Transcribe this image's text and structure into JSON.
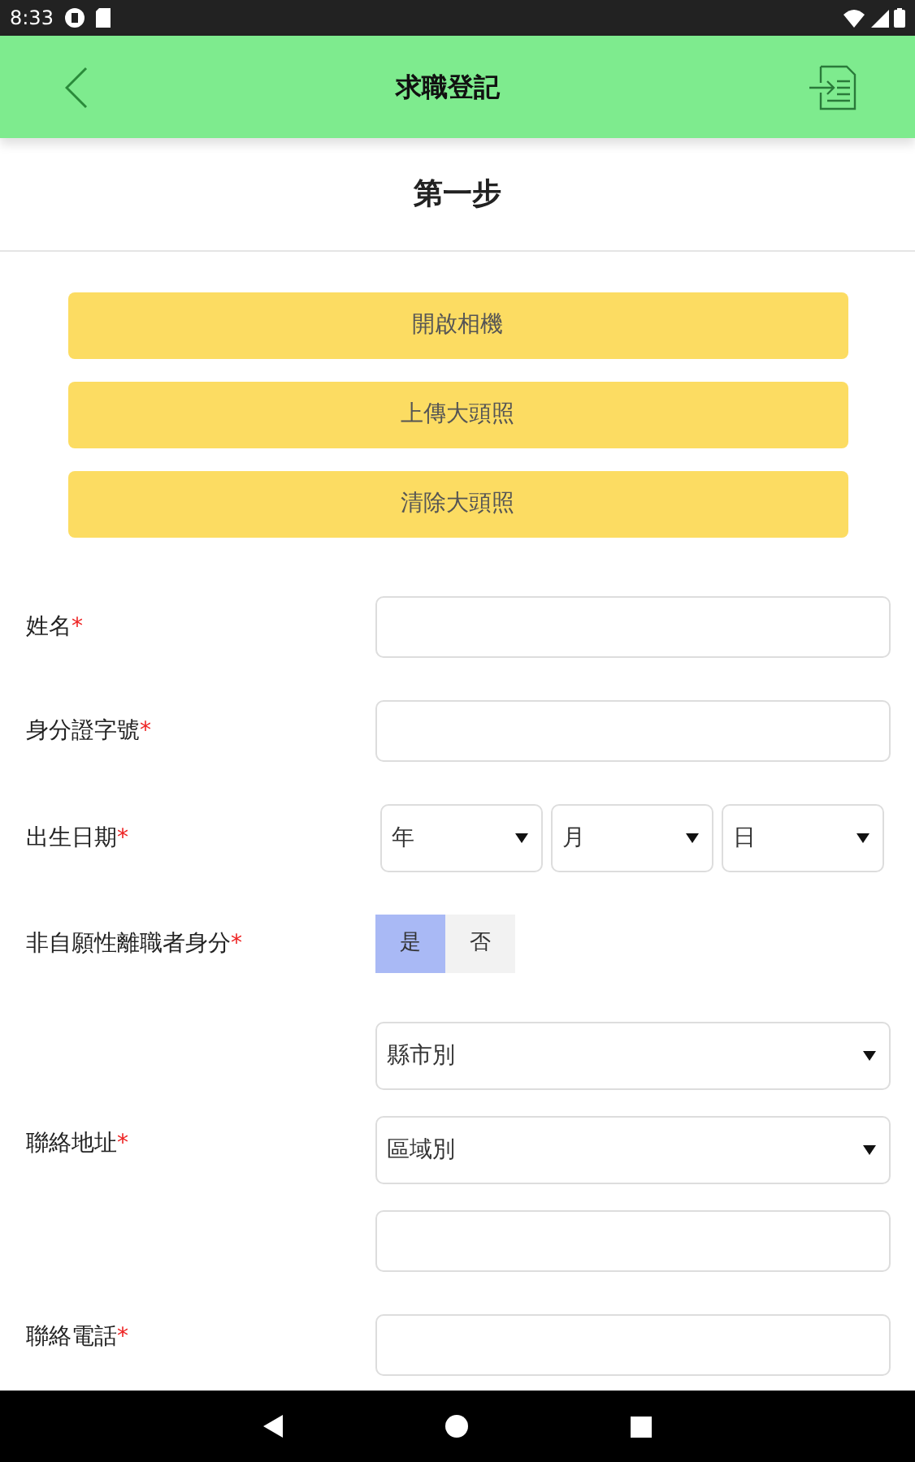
{
  "status_bar": {
    "time": "8:33"
  },
  "app_bar": {
    "title": "求職登記"
  },
  "step_title": "第一步",
  "photo_buttons": [
    "開啟相機",
    "上傳大頭照",
    "清除大頭照"
  ],
  "fields": [
    {
      "kind": "text",
      "label": "姓名",
      "required_mark": "*"
    },
    {
      "kind": "text",
      "label": "身分證字號",
      "required_mark": "*"
    },
    {
      "kind": "date",
      "label": "出生日期",
      "required_mark": "*",
      "selects": [
        {
          "value": "年"
        },
        {
          "value": "月"
        },
        {
          "value": "日"
        }
      ]
    },
    {
      "kind": "toggle",
      "label": "非自願性離職者身分",
      "required_mark": "*",
      "options": [
        {
          "label": "是",
          "selected": true
        },
        {
          "label": "否",
          "selected": false
        }
      ]
    },
    {
      "kind": "address",
      "label": "聯絡地址",
      "required_mark": "*",
      "selects": [
        {
          "value": "縣市別"
        },
        {
          "value": "區域別"
        }
      ]
    },
    {
      "kind": "text",
      "label": "聯絡電話",
      "required_mark": "*"
    }
  ]
}
